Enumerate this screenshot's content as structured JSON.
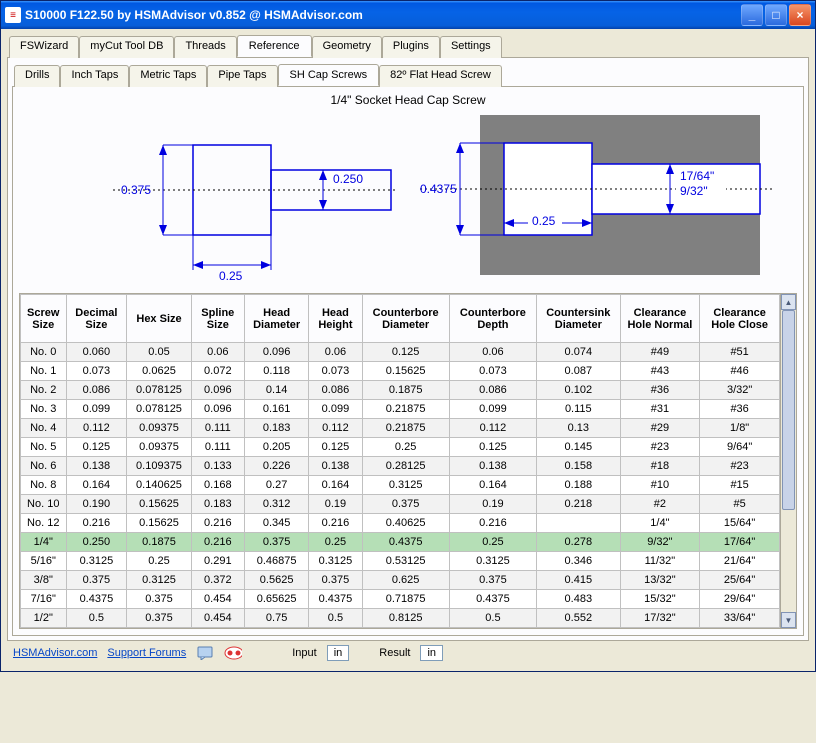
{
  "window": {
    "title": "S10000 F122.50 by HSMAdvisor v0.852 @ HSMAdvisor.com"
  },
  "tabs": {
    "main": [
      "FSWizard",
      "myCut Tool DB",
      "Threads",
      "Reference",
      "Geometry",
      "Plugins",
      "Settings"
    ],
    "main_active": 3,
    "sub": [
      "Drills",
      "Inch Taps",
      "Metric Taps",
      "Pipe Taps",
      "SH Cap Screws",
      "82º Flat Head Screw"
    ],
    "sub_active": 4
  },
  "diagram": {
    "title": "1/4\" Socket Head Cap Screw",
    "left": {
      "height": "0.375",
      "width": "0.25",
      "shaft_dia": "0.250"
    },
    "right": {
      "cb_dia": "0.4375",
      "cb_depth": "0.25",
      "clr_normal": "17/64\"",
      "clr_close": "9/32\""
    }
  },
  "table": {
    "headers": [
      "Screw Size",
      "Decimal Size",
      "Hex Size",
      "Spline Size",
      "Head Diameter",
      "Head Height",
      "Counterbore Diameter",
      "Counterbore Depth",
      "Countersink Diameter",
      "Clearance Hole Normal",
      "Clearance Hole Close"
    ],
    "selected_index": 10,
    "rows": [
      [
        "No. 0",
        "0.060",
        "0.05",
        "0.06",
        "0.096",
        "0.06",
        "0.125",
        "0.06",
        "0.074",
        "#49",
        "#51"
      ],
      [
        "No. 1",
        "0.073",
        "0.0625",
        "0.072",
        "0.118",
        "0.073",
        "0.15625",
        "0.073",
        "0.087",
        "#43",
        "#46"
      ],
      [
        "No. 2",
        "0.086",
        "0.078125",
        "0.096",
        "0.14",
        "0.086",
        "0.1875",
        "0.086",
        "0.102",
        "#36",
        "3/32\""
      ],
      [
        "No. 3",
        "0.099",
        "0.078125",
        "0.096",
        "0.161",
        "0.099",
        "0.21875",
        "0.099",
        "0.115",
        "#31",
        "#36"
      ],
      [
        "No. 4",
        "0.112",
        "0.09375",
        "0.111",
        "0.183",
        "0.112",
        "0.21875",
        "0.112",
        "0.13",
        "#29",
        "1/8\""
      ],
      [
        "No. 5",
        "0.125",
        "0.09375",
        "0.111",
        "0.205",
        "0.125",
        "0.25",
        "0.125",
        "0.145",
        "#23",
        "9/64\""
      ],
      [
        "No. 6",
        "0.138",
        "0.109375",
        "0.133",
        "0.226",
        "0.138",
        "0.28125",
        "0.138",
        "0.158",
        "#18",
        "#23"
      ],
      [
        "No. 8",
        "0.164",
        "0.140625",
        "0.168",
        "0.27",
        "0.164",
        "0.3125",
        "0.164",
        "0.188",
        "#10",
        "#15"
      ],
      [
        "No. 10",
        "0.190",
        "0.15625",
        "0.183",
        "0.312",
        "0.19",
        "0.375",
        "0.19",
        "0.218",
        "#2",
        "#5"
      ],
      [
        "No. 12",
        "0.216",
        "0.15625",
        "0.216",
        "0.345",
        "0.216",
        "0.40625",
        "0.216",
        "",
        "1/4\"",
        "15/64\""
      ],
      [
        "1/4\"",
        "0.250",
        "0.1875",
        "0.216",
        "0.375",
        "0.25",
        "0.4375",
        "0.25",
        "0.278",
        "9/32\"",
        "17/64\""
      ],
      [
        "5/16\"",
        "0.3125",
        "0.25",
        "0.291",
        "0.46875",
        "0.3125",
        "0.53125",
        "0.3125",
        "0.346",
        "11/32\"",
        "21/64\""
      ],
      [
        "3/8\"",
        "0.375",
        "0.3125",
        "0.372",
        "0.5625",
        "0.375",
        "0.625",
        "0.375",
        "0.415",
        "13/32\"",
        "25/64\""
      ],
      [
        "7/16\"",
        "0.4375",
        "0.375",
        "0.454",
        "0.65625",
        "0.4375",
        "0.71875",
        "0.4375",
        "0.483",
        "15/32\"",
        "29/64\""
      ],
      [
        "1/2\"",
        "0.5",
        "0.375",
        "0.454",
        "0.75",
        "0.5",
        "0.8125",
        "0.5",
        "0.552",
        "17/32\"",
        "33/64\""
      ]
    ]
  },
  "status": {
    "link1": "HSMAdvisor.com",
    "link2": "Support Forums",
    "input_label": "Input",
    "input_unit": "in",
    "result_label": "Result",
    "result_unit": "in"
  }
}
